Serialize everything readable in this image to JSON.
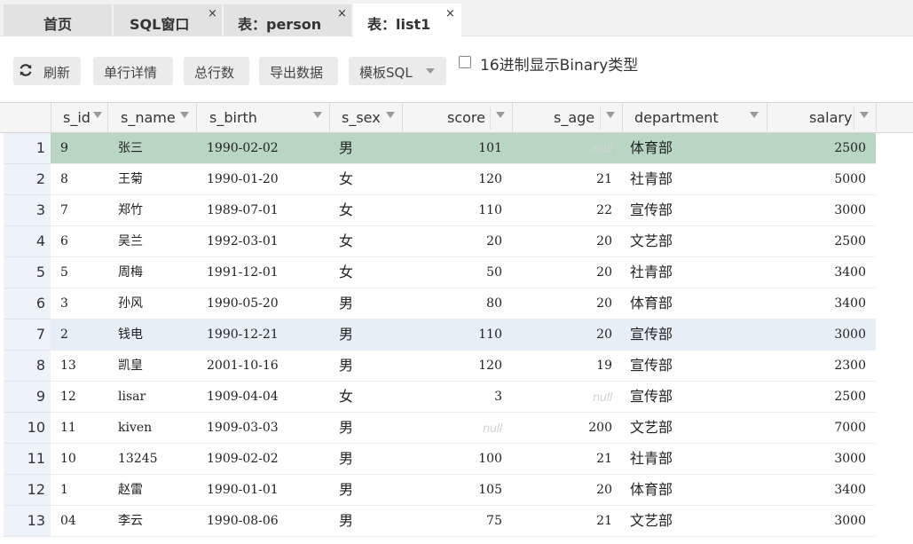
{
  "tabs": [
    {
      "label": "首页",
      "closable": false,
      "active": false
    },
    {
      "label": "SQL窗口",
      "closable": true,
      "active": false
    },
    {
      "label": "表：person",
      "closable": true,
      "active": false
    },
    {
      "label": "表：list1",
      "closable": true,
      "active": true
    }
  ],
  "tab_close_glyph": "×",
  "toolbar": {
    "refresh_label": "刷新",
    "row_detail_label": "单行详情",
    "total_rows_label": "总行数",
    "export_label": "导出数据",
    "template_sql_label": "模板SQL",
    "binary_hex_label": "16进制显示Binary类型",
    "binary_hex_checked": false
  },
  "columns": [
    "s_id",
    "s_name",
    "s_birth",
    "s_sex",
    "score",
    "s_age",
    "department",
    "salary"
  ],
  "null_text": "null",
  "rows": [
    {
      "n": "1",
      "s_id": "9",
      "s_name": "张三",
      "s_birth": "1990-02-02",
      "s_sex": "男",
      "score": "101",
      "s_age": null,
      "department": "体育部",
      "salary": "2500"
    },
    {
      "n": "2",
      "s_id": "8",
      "s_name": "王菊",
      "s_birth": "1990-01-20",
      "s_sex": "女",
      "score": "120",
      "s_age": "21",
      "department": "社青部",
      "salary": "5000"
    },
    {
      "n": "3",
      "s_id": "7",
      "s_name": "郑竹",
      "s_birth": "1989-07-01",
      "s_sex": "女",
      "score": "110",
      "s_age": "22",
      "department": "宣传部",
      "salary": "3000"
    },
    {
      "n": "4",
      "s_id": "6",
      "s_name": "吴兰",
      "s_birth": "1992-03-01",
      "s_sex": "女",
      "score": "20",
      "s_age": "20",
      "department": "文艺部",
      "salary": "2500"
    },
    {
      "n": "5",
      "s_id": "5",
      "s_name": "周梅",
      "s_birth": "1991-12-01",
      "s_sex": "女",
      "score": "50",
      "s_age": "20",
      "department": "社青部",
      "salary": "3400"
    },
    {
      "n": "6",
      "s_id": "3",
      "s_name": "孙风",
      "s_birth": "1990-05-20",
      "s_sex": "男",
      "score": "80",
      "s_age": "20",
      "department": "体育部",
      "salary": "3400"
    },
    {
      "n": "7",
      "s_id": "2",
      "s_name": "钱电",
      "s_birth": "1990-12-21",
      "s_sex": "男",
      "score": "110",
      "s_age": "20",
      "department": "宣传部",
      "salary": "3000"
    },
    {
      "n": "8",
      "s_id": "13",
      "s_name": "凯皇",
      "s_birth": "2001-10-16",
      "s_sex": "男",
      "score": "120",
      "s_age": "19",
      "department": "宣传部",
      "salary": "2300"
    },
    {
      "n": "9",
      "s_id": "12",
      "s_name": "lisar",
      "s_birth": "1909-04-04",
      "s_sex": "女",
      "score": "3",
      "s_age": null,
      "department": "宣传部",
      "salary": "2500"
    },
    {
      "n": "10",
      "s_id": "11",
      "s_name": "kiven",
      "s_birth": "1909-03-03",
      "s_sex": "男",
      "score": null,
      "s_age": "200",
      "department": "文艺部",
      "salary": "7000"
    },
    {
      "n": "11",
      "s_id": "10",
      "s_name": "13245",
      "s_birth": "1909-02-02",
      "s_sex": "男",
      "score": "100",
      "s_age": "21",
      "department": "社青部",
      "salary": "3000"
    },
    {
      "n": "12",
      "s_id": "1",
      "s_name": "赵雷",
      "s_birth": "1990-01-01",
      "s_sex": "男",
      "score": "105",
      "s_age": "20",
      "department": "体育部",
      "salary": "3400"
    },
    {
      "n": "13",
      "s_id": "04",
      "s_name": "李云",
      "s_birth": "1990-08-06",
      "s_sex": "男",
      "score": "75",
      "s_age": "21",
      "department": "文艺部",
      "salary": "3000"
    }
  ],
  "selected_row": "1",
  "hover_row": "7",
  "colors": {
    "selected_row": "#b9d6c2",
    "hover_row": "#e6eef7",
    "null_text": "#d4d4d4"
  }
}
